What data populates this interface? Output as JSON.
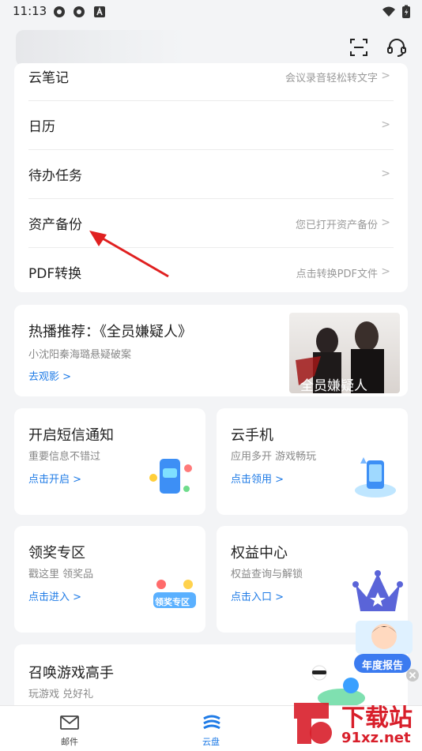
{
  "status": {
    "time": "11:13"
  },
  "list": [
    {
      "label": "云笔记",
      "hint": "会议录音轻松转文字"
    },
    {
      "label": "日历",
      "hint": ""
    },
    {
      "label": "待办任务",
      "hint": ""
    },
    {
      "label": "资产备份",
      "hint": "您已打开资产备份"
    },
    {
      "label": "PDF转换",
      "hint": "点击转换PDF文件"
    }
  ],
  "promo": {
    "title": "热播推荐：《全员嫌疑人》",
    "subtitle": "小沈阳秦海璐悬疑破案",
    "link": "去观影",
    "poster_text": "全员嫌疑人"
  },
  "tiles": [
    {
      "title": "开启短信通知",
      "subtitle": "重要信息不错过",
      "link": "点击开启"
    },
    {
      "title": "云手机",
      "subtitle": "应用多开 游戏畅玩",
      "link": "点击领用"
    },
    {
      "title": "领奖专区",
      "subtitle": "戳这里 领奖品",
      "link": "点击进入",
      "badge": "领奖专区"
    },
    {
      "title": "权益中心",
      "subtitle": "权益查询与解锁",
      "link": "点击入口"
    },
    {
      "title": "召唤游戏高手",
      "subtitle": "玩游戏 兑好礼",
      "link": ""
    }
  ],
  "float_badge": {
    "label": "年度报告"
  },
  "nav": [
    {
      "label": "邮件"
    },
    {
      "label": "云盘"
    }
  ],
  "watermark": {
    "text": "下载站",
    "url": "91xz.net"
  },
  "colors": {
    "accent": "#1f7be6",
    "arrow": "#e02020"
  }
}
